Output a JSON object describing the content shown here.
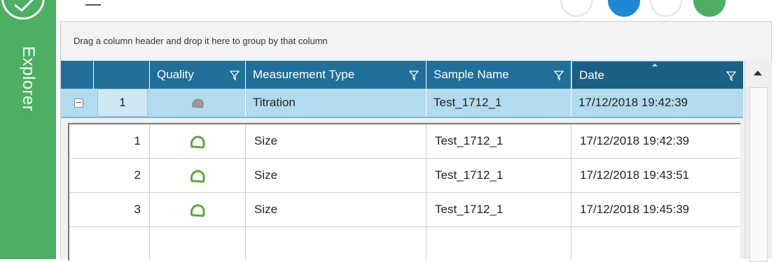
{
  "explorer": {
    "label": "Explorer"
  },
  "grid": {
    "group_hint": "Drag a column header and drop it here to group by that column",
    "columns": [
      {
        "label": ""
      },
      {
        "label": ""
      },
      {
        "label": "Quality"
      },
      {
        "label": "Measurement Type"
      },
      {
        "label": "Sample Name"
      },
      {
        "label": "Date"
      }
    ],
    "parent_row": {
      "index": "1",
      "quality_icon": "grey-quality-icon",
      "measurement_type": "Titration",
      "sample_name": "Test_1712_1",
      "date": "17/12/2018 19:42:39"
    },
    "child_rows": [
      {
        "index": "1",
        "quality_icon": "green-quality-icon",
        "measurement_type": "Size",
        "sample_name": "Test_1712_1",
        "date": "17/12/2018 19:42:39"
      },
      {
        "index": "2",
        "quality_icon": "green-quality-icon",
        "measurement_type": "Size",
        "sample_name": "Test_1712_1",
        "date": "17/12/2018 19:43:51"
      },
      {
        "index": "3",
        "quality_icon": "green-quality-icon",
        "measurement_type": "Size",
        "sample_name": "Test_1712_1",
        "date": "17/12/2018 19:45:39"
      }
    ],
    "colors": {
      "header": "#1f6f98",
      "selected_row": "#b2dbef",
      "good_quality": "#5aa83a",
      "neutral_quality": "#9a9a9a"
    }
  }
}
